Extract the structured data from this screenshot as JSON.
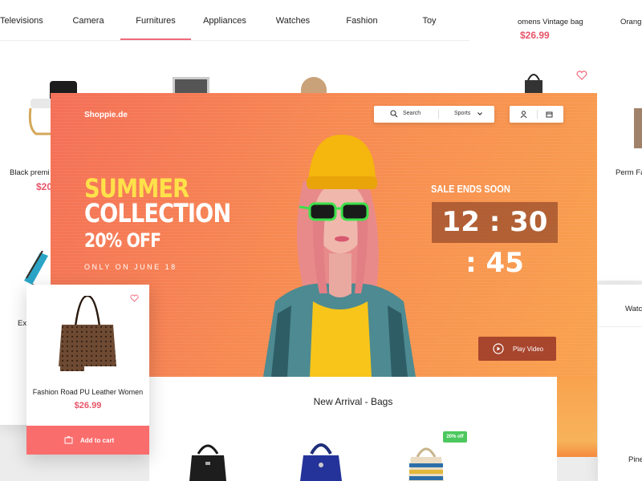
{
  "categories": {
    "items": [
      "Televisions",
      "Camera",
      "Furnitures",
      "Appliances",
      "Watches",
      "Fashion",
      "Toy"
    ],
    "active": "Furnitures"
  },
  "background_products": {
    "left_name": "Black premi",
    "left_price": "$20",
    "left_name2": "Ex",
    "right_top_name": "omens Vintage bag",
    "right_top_price": "$26.99",
    "right_top_name2": "Orang",
    "right_mid_name": "Perm Fa",
    "right_low_label": "Watc",
    "right_bottom_name": "Pine"
  },
  "header": {
    "brand": "Shoppie.de",
    "search_placeholder": "Search",
    "category_select": "Sports"
  },
  "hero": {
    "line1": "SUMMER",
    "line2": "COLLECTION",
    "line3": "20% OFF",
    "line4": "ONLY ON JUNE 18",
    "sale_title": "SALE ENDS SOON",
    "timer": "12 : 30 : 45",
    "play_label": "Play Video",
    "colors": {
      "accent_yellow": "#ffe14a",
      "orange": "#f78a52"
    }
  },
  "arrival": {
    "title": "New Arrival - Bags",
    "badge": "20% off"
  },
  "featured": {
    "name": "Fashion Road PU Leather Women",
    "price": "$26.99",
    "cart_label": "Add to cart",
    "colors": {
      "price": "#e85469",
      "cart": "#fa6d6d"
    }
  }
}
